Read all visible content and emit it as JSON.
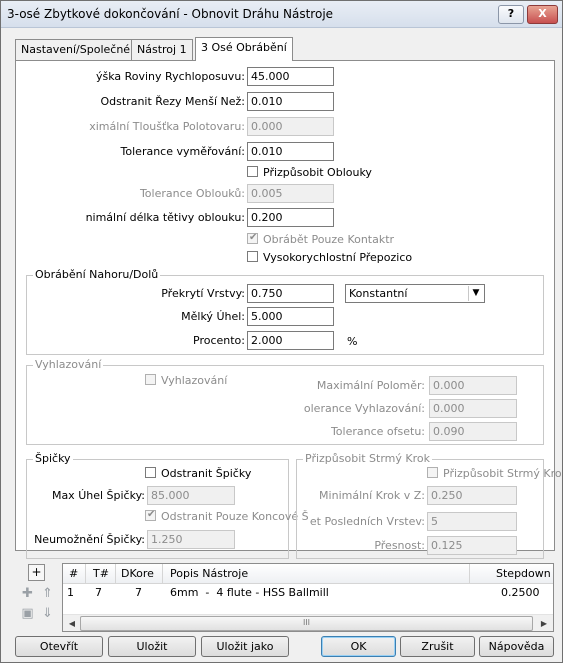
{
  "window": {
    "title": "3-osé Zbytkové dokončování - Obnovit Dráhu Nástroje",
    "help_label": "?",
    "close_label": "X"
  },
  "tabs": [
    "Nastavení/Společné",
    "Nástroj 1",
    "3 Osé Obrábění"
  ],
  "fields": {
    "retract_label": "ýška Roviny Rychloposuvu:",
    "retract_value": "45.000",
    "remove_cuts_label": "Odstranit Řezy Menší Než:",
    "remove_cuts_value": "0.010",
    "max_stock_label": "ximální Tloušťka Polotovaru:",
    "max_stock_value": "0.000",
    "tolerance_label": "Tolerance vyměřování:",
    "tolerance_value": "0.010",
    "fit_arcs_label": "Přizpůsobit Oblouky",
    "arc_tol_label": "Tolerance Oblouků:",
    "arc_tol_value": "0.005",
    "min_chord_label": "nimální délka tětivy oblouku:",
    "min_chord_value": "0.200",
    "contact_only_label": "Obrábět Pouze Kontaktr",
    "hs_link_label": "Vysokorychlostní Přepozico"
  },
  "updown": {
    "title": "Obrábění Nahoru/Dolů",
    "overlap_label": "Překrytí Vrstvy:",
    "overlap_value": "0.750",
    "overlap_mode": "Konstantní",
    "shallow_label": "Mělký Úhel:",
    "shallow_value": "5.000",
    "percent_label": "Procento:",
    "percent_value": "2.000",
    "percent_unit": "%"
  },
  "smoothing": {
    "title": "Vyhlazování",
    "check_label": "Vyhlazování",
    "max_radius_label": "Maximální Poloměr:",
    "max_radius_value": "0.000",
    "tolerance_label": "olerance Vyhlazování:",
    "tolerance_value": "0.000",
    "offset_tol_label": "Tolerance ofsetu:",
    "offset_tol_value": "0.090"
  },
  "cusps": {
    "title": "Špičky",
    "remove_label": "Odstranit Špičky",
    "max_angle_label": "Max Úhel Špičky:",
    "max_angle_value": "85.000",
    "remove_end_label": "Odstranit Pouze Koncové Š",
    "disable_label": "Neumožnění Špičky:",
    "disable_value": "1.250"
  },
  "steep": {
    "title": "Přizpůsobit Strmý Krok",
    "check_label": "Přizpůsobit Strmý Kro",
    "min_step_label": "Minimální Krok v Z:",
    "min_step_value": "0.250",
    "last_passes_label": "et Posledních Vrstev:",
    "last_passes_value": "5",
    "precision_label": "Přesnost:",
    "precision_value": "0.125"
  },
  "tool_list": {
    "headers": [
      "#",
      "T#",
      "DKore",
      "Popis Nástroje",
      "Stepdown"
    ],
    "rows": [
      {
        "n": "1",
        "t": "7",
        "dk": "7",
        "desc": "6mm  -  4 flute - HSS Ballmill",
        "stepdown": "0.2500"
      }
    ],
    "scroll_grip": "III"
  },
  "side_tools": {
    "add": "+"
  },
  "buttons": {
    "open": "Otevřít",
    "save": "Uložit",
    "save_as": "Uložit jako",
    "ok": "OK",
    "cancel": "Zrušit",
    "help": "Nápověda"
  }
}
